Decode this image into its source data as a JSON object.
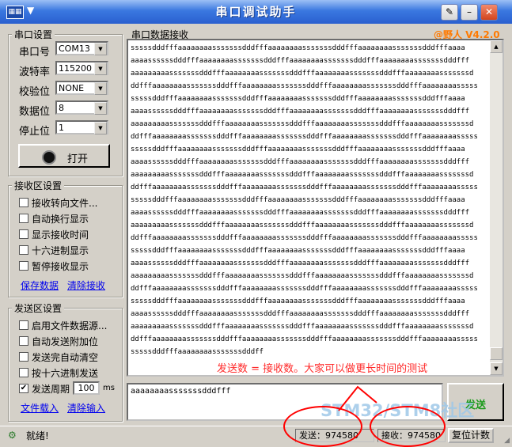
{
  "window": {
    "title": "串口调试助手",
    "version_tag": "@野人 V4.2.0"
  },
  "serial": {
    "group_title": "串口设置",
    "port_label": "串口号",
    "port_value": "COM13",
    "baud_label": "波特率",
    "baud_value": "115200",
    "parity_label": "校验位",
    "parity_value": "NONE",
    "databits_label": "数据位",
    "databits_value": "8",
    "stopbits_label": "停止位",
    "stopbits_value": "1",
    "open_label": "打开"
  },
  "receive_settings": {
    "group_title": "接收区设置",
    "options": [
      {
        "label": "接收转向文件...",
        "checked": false
      },
      {
        "label": "自动换行显示",
        "checked": false
      },
      {
        "label": "显示接收时间",
        "checked": false
      },
      {
        "label": "十六进制显示",
        "checked": false
      },
      {
        "label": "暂停接收显示",
        "checked": false
      }
    ],
    "save_link": "保存数据",
    "clear_link": "清除接收"
  },
  "send_settings": {
    "group_title": "发送区设置",
    "options": [
      {
        "label": "启用文件数据源...",
        "checked": false
      },
      {
        "label": "自动发送附加位",
        "checked": false
      },
      {
        "label": "发送完自动清空",
        "checked": false
      },
      {
        "label": "按十六进制发送",
        "checked": false
      },
      {
        "label": "发送周期",
        "checked": true
      }
    ],
    "period_value": "100",
    "period_unit": "ms",
    "load_link": "文件载入",
    "clear_link": "清除输入"
  },
  "receive_area": {
    "title": "串口数据接收",
    "lines": [
      "sssssdddfffaaaaaaaasssssssdddfffaaaaaaaasssssssdddfffaaaaaaaasssssssdddfffaaaa",
      "aaaassssssdddfffaaaaaaaasssssssdddfffaaaaaaaasssssssdddfffaaaaaaaasssssssdddfff",
      "aaaaaaaaasssssssdddfffaaaaaaaasssssssdddfffaaaaaaaasssssssdddfffaaaaaaaasssssssd",
      "ddfffaaaaaaaasssssssdddfffaaaaaaaasssssssdddfffaaaaaaaasssssssdddfffaaaaaaaasssss",
      "sssssdddfffaaaaaaaasssssssdddfffaaaaaaaasssssssdddfffaaaaaaaasssssssdddfffaaaa",
      "aaaassssssdddfffaaaaaaaasssssssdddfffaaaaaaaasssssssdddfffaaaaaaaasssssssdddfff",
      "aaaaaaaaasssssssdddfffaaaaaaaasssssssdddfffaaaaaaaasssssssdddfffaaaaaaaasssssssd",
      "ddfffaaaaaaaasssssssdddfffaaaaaaaasssssssdddfffaaaaaaaasssssssdddfffaaaaaaaasssss",
      "sssssdddfffaaaaaaaasssssssdddfffaaaaaaaasssssssdddfffaaaaaaaasssssssdddfffaaaa",
      "aaaassssssdddfffaaaaaaaasssssssdddfffaaaaaaaasssssssdddfffaaaaaaaasssssssdddfff",
      "aaaaaaaaasssssssdddfffaaaaaaaasssssssdddfffaaaaaaaasssssssdddfffaaaaaaaasssssssd",
      "ddfffaaaaaaaasssssssdddfffaaaaaaaasssssssdddfffaaaaaaaasssssssdddfffaaaaaaaasssss",
      "sssssdddfffaaaaaaaasssssssdddfffaaaaaaaasssssssdddfffaaaaaaaasssssssdddfffaaaa",
      "aaaassssssdddfffaaaaaaaasssssssdddfffaaaaaaaasssssssdddfffaaaaaaaasssssssdddfff",
      "aaaaaaaaasssssssdddfffaaaaaaaasssssssdddfffaaaaaaaasssssssdddfffaaaaaaaasssssssd",
      "ddfffaaaaaaaasssssssdddfffaaaaaaaasssssssdddfffaaaaaaaasssssssdddfffaaaaaaaasssss",
      "sssssdddfffaaaaaaaasssssssdddfffaaaaaaaasssssssdddfffaaaaaaaasssssssdddfffaaaa",
      "aaaassssssdddfffaaaaaaaasssssssdddfffaaaaaaaasssssssdddfffaaaaaaaasssssssdddfff",
      "aaaaaaaaasssssssdddfffaaaaaaaasssssssdddfffaaaaaaaasssssssdddfffaaaaaaaasssssssd",
      "ddfffaaaaaaaasssssssdddfffaaaaaaaasssssssdddfffaaaaaaaasssssssdddfffaaaaaaaasssss",
      "sssssdddfffaaaaaaaasssssssdddfffaaaaaaaasssssssdddfffaaaaaaaasssssssdddfffaaaa",
      "aaaassssssdddfffaaaaaaaasssssssdddfffaaaaaaaasssssssdddfffaaaaaaaasssssssdddfff",
      "aaaaaaaaasssssssdddfffaaaaaaaasssssssdddfffaaaaaaaasssssssdddfffaaaaaaaasssssssd",
      "ddfffaaaaaaaasssssssdddfffaaaaaaaasssssssdddfffaaaaaaaasssssssdddfffaaaaaaaasssss",
      "sssssdddfffaaaaaaaasssssssdddff"
    ],
    "note": "发送数 = 接收数。大家可以做更长时间的测试"
  },
  "send_area": {
    "text": "aaaaaaaasssssssdddfff",
    "send_label": "发送"
  },
  "status": {
    "ready": "就绪!",
    "sent": "发送：974580",
    "received": "接收：974580",
    "reset_label": "复位计数"
  },
  "watermark": "STM32/STM8社区"
}
